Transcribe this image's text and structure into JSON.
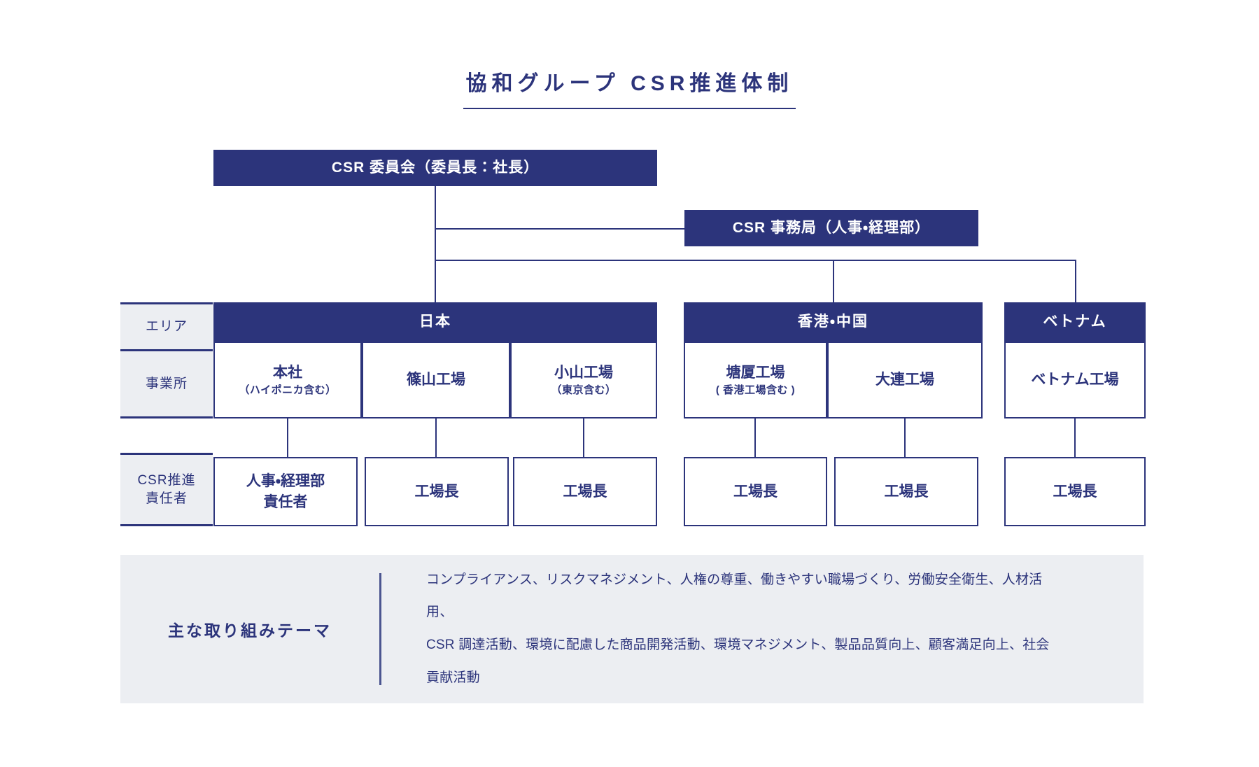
{
  "title": "協和グループ CSR推進体制",
  "colors": {
    "navy": "#2C347B",
    "panel_gray": "#ECEEF2",
    "white": "#FFFFFF"
  },
  "top": {
    "committee": "CSR 委員会（委員長：社長）",
    "secretariat": "CSR 事務局（人事・経理部）"
  },
  "row_labels": {
    "area": "エリア",
    "office": "事業所",
    "csr_manager_line1": "CSR推進",
    "csr_manager_line2": "責任者"
  },
  "areas": [
    {
      "name": "日本",
      "offices": [
        {
          "name": "本社",
          "note": "（ハイポニカ含む）",
          "manager_line1": "人事・経理部",
          "manager_line2": "責任者"
        },
        {
          "name": "篠山工場",
          "note": "",
          "manager_line1": "工場長",
          "manager_line2": ""
        },
        {
          "name": "小山工場",
          "note": "（東京含む）",
          "manager_line1": "工場長",
          "manager_line2": ""
        }
      ]
    },
    {
      "name": "香港・中国",
      "offices": [
        {
          "name": "塘厦工場",
          "note": "( 香港工場含む )",
          "manager_line1": "工場長",
          "manager_line2": ""
        },
        {
          "name": "大連工場",
          "note": "",
          "manager_line1": "工場長",
          "manager_line2": ""
        }
      ]
    },
    {
      "name": "ベトナム",
      "offices": [
        {
          "name": "ベトナム工場",
          "note": "",
          "manager_line1": "工場長",
          "manager_line2": ""
        }
      ]
    }
  ],
  "themes": {
    "label": "主な取り組みテーマ",
    "line1": "コンプライアンス、リスクマネジメント、人権の尊重、働きやすい職場づくり、労働安全衛生、人材活用、",
    "line2": "CSR 調達活動、環境に配慮した商品開発活動、環境マネジメント、製品品質向上、顧客満足向上、社会",
    "line3": "貢献活動"
  }
}
